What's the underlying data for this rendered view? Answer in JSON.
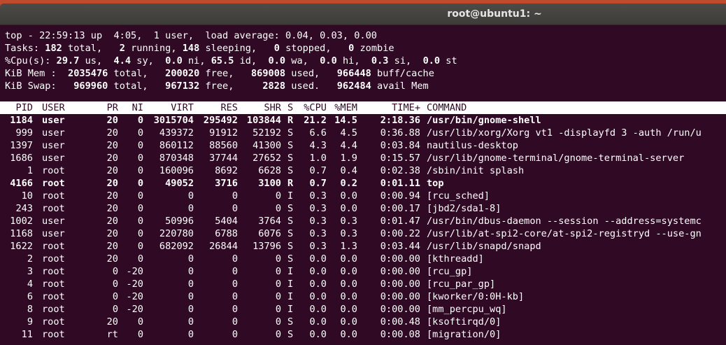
{
  "window": {
    "title": "root@ubuntu1: ~"
  },
  "summary": [
    {
      "parts": [
        {
          "t": "top - 22:59:13 up  4:05,  1 user,  load average: 0.04, 0.03, 0.00"
        }
      ]
    },
    {
      "parts": [
        {
          "t": "Tasks: "
        },
        {
          "t": "182",
          "b": true
        },
        {
          "t": " total,   "
        },
        {
          "t": "2",
          "b": true
        },
        {
          "t": " running, "
        },
        {
          "t": "148",
          "b": true
        },
        {
          "t": " sleeping,   "
        },
        {
          "t": "0",
          "b": true
        },
        {
          "t": " stopped,   "
        },
        {
          "t": "0",
          "b": true
        },
        {
          "t": " zombie"
        }
      ]
    },
    {
      "parts": [
        {
          "t": "%Cpu(s): "
        },
        {
          "t": "29.7",
          "b": true
        },
        {
          "t": " us,  "
        },
        {
          "t": "4.4",
          "b": true
        },
        {
          "t": " sy,  "
        },
        {
          "t": "0.0",
          "b": true
        },
        {
          "t": " ni, "
        },
        {
          "t": "65.5",
          "b": true
        },
        {
          "t": " id,  "
        },
        {
          "t": "0.0",
          "b": true
        },
        {
          "t": " wa,  "
        },
        {
          "t": "0.0",
          "b": true
        },
        {
          "t": " hi,  "
        },
        {
          "t": "0.3",
          "b": true
        },
        {
          "t": " si,  "
        },
        {
          "t": "0.0",
          "b": true
        },
        {
          "t": " st"
        }
      ]
    },
    {
      "parts": [
        {
          "t": "KiB Mem : "
        },
        {
          "t": " 2035476",
          "b": true
        },
        {
          "t": " total,  "
        },
        {
          "t": " 200020",
          "b": true
        },
        {
          "t": " free,  "
        },
        {
          "t": " 869008",
          "b": true
        },
        {
          "t": " used,  "
        },
        {
          "t": " 966448",
          "b": true
        },
        {
          "t": " buff/cache"
        }
      ]
    },
    {
      "parts": [
        {
          "t": "KiB Swap: "
        },
        {
          "t": "  969960",
          "b": true
        },
        {
          "t": " total,  "
        },
        {
          "t": " 967132",
          "b": true
        },
        {
          "t": " free,  "
        },
        {
          "t": "   2828",
          "b": true
        },
        {
          "t": " used.  "
        },
        {
          "t": " 962484",
          "b": true
        },
        {
          "t": " avail Mem"
        }
      ]
    }
  ],
  "columns": [
    "PID",
    "USER",
    "PR",
    "NI",
    "VIRT",
    "RES",
    "SHR",
    "S",
    "%CPU",
    "%MEM",
    "TIME+",
    "COMMAND"
  ],
  "processes": [
    {
      "pid": "1184",
      "user": "user",
      "pr": "20",
      "ni": "0",
      "virt": "3015704",
      "res": "295492",
      "shr": "103844",
      "s": "R",
      "cpu": "21.2",
      "mem": "14.5",
      "time": "2:18.36",
      "cmd": "/usr/bin/gnome-shell",
      "bold": true
    },
    {
      "pid": "999",
      "user": "user",
      "pr": "20",
      "ni": "0",
      "virt": "439372",
      "res": "91912",
      "shr": "52192",
      "s": "S",
      "cpu": "6.6",
      "mem": "4.5",
      "time": "0:36.88",
      "cmd": "/usr/lib/xorg/Xorg vt1 -displayfd 3 -auth /run/u",
      "bold": false
    },
    {
      "pid": "1397",
      "user": "user",
      "pr": "20",
      "ni": "0",
      "virt": "860112",
      "res": "88560",
      "shr": "41300",
      "s": "S",
      "cpu": "4.3",
      "mem": "4.4",
      "time": "0:03.84",
      "cmd": "nautilus-desktop",
      "bold": false
    },
    {
      "pid": "1686",
      "user": "user",
      "pr": "20",
      "ni": "0",
      "virt": "870348",
      "res": "37744",
      "shr": "27652",
      "s": "S",
      "cpu": "1.0",
      "mem": "1.9",
      "time": "0:15.57",
      "cmd": "/usr/lib/gnome-terminal/gnome-terminal-server",
      "bold": false
    },
    {
      "pid": "1",
      "user": "root",
      "pr": "20",
      "ni": "0",
      "virt": "160096",
      "res": "8692",
      "shr": "6628",
      "s": "S",
      "cpu": "0.7",
      "mem": "0.4",
      "time": "0:02.38",
      "cmd": "/sbin/init splash",
      "bold": false
    },
    {
      "pid": "4166",
      "user": "root",
      "pr": "20",
      "ni": "0",
      "virt": "49052",
      "res": "3716",
      "shr": "3100",
      "s": "R",
      "cpu": "0.7",
      "mem": "0.2",
      "time": "0:01.11",
      "cmd": "top",
      "bold": true
    },
    {
      "pid": "10",
      "user": "root",
      "pr": "20",
      "ni": "0",
      "virt": "0",
      "res": "0",
      "shr": "0",
      "s": "I",
      "cpu": "0.3",
      "mem": "0.0",
      "time": "0:00.94",
      "cmd": "[rcu_sched]",
      "bold": false
    },
    {
      "pid": "243",
      "user": "root",
      "pr": "20",
      "ni": "0",
      "virt": "0",
      "res": "0",
      "shr": "0",
      "s": "S",
      "cpu": "0.3",
      "mem": "0.0",
      "time": "0:00.17",
      "cmd": "[jbd2/sda1-8]",
      "bold": false
    },
    {
      "pid": "1002",
      "user": "user",
      "pr": "20",
      "ni": "0",
      "virt": "50996",
      "res": "5404",
      "shr": "3764",
      "s": "S",
      "cpu": "0.3",
      "mem": "0.3",
      "time": "0:01.47",
      "cmd": "/usr/bin/dbus-daemon --session --address=systemc",
      "bold": false
    },
    {
      "pid": "1168",
      "user": "user",
      "pr": "20",
      "ni": "0",
      "virt": "220780",
      "res": "6788",
      "shr": "6076",
      "s": "S",
      "cpu": "0.3",
      "mem": "0.3",
      "time": "0:00.22",
      "cmd": "/usr/lib/at-spi2-core/at-spi2-registryd --use-gn",
      "bold": false
    },
    {
      "pid": "1622",
      "user": "root",
      "pr": "20",
      "ni": "0",
      "virt": "682092",
      "res": "26844",
      "shr": "13796",
      "s": "S",
      "cpu": "0.3",
      "mem": "1.3",
      "time": "0:03.44",
      "cmd": "/usr/lib/snapd/snapd",
      "bold": false
    },
    {
      "pid": "2",
      "user": "root",
      "pr": "20",
      "ni": "0",
      "virt": "0",
      "res": "0",
      "shr": "0",
      "s": "S",
      "cpu": "0.0",
      "mem": "0.0",
      "time": "0:00.00",
      "cmd": "[kthreadd]",
      "bold": false
    },
    {
      "pid": "3",
      "user": "root",
      "pr": "0",
      "ni": "-20",
      "virt": "0",
      "res": "0",
      "shr": "0",
      "s": "I",
      "cpu": "0.0",
      "mem": "0.0",
      "time": "0:00.00",
      "cmd": "[rcu_gp]",
      "bold": false
    },
    {
      "pid": "4",
      "user": "root",
      "pr": "0",
      "ni": "-20",
      "virt": "0",
      "res": "0",
      "shr": "0",
      "s": "I",
      "cpu": "0.0",
      "mem": "0.0",
      "time": "0:00.00",
      "cmd": "[rcu_par_gp]",
      "bold": false
    },
    {
      "pid": "6",
      "user": "root",
      "pr": "0",
      "ni": "-20",
      "virt": "0",
      "res": "0",
      "shr": "0",
      "s": "I",
      "cpu": "0.0",
      "mem": "0.0",
      "time": "0:00.00",
      "cmd": "[kworker/0:0H-kb]",
      "bold": false
    },
    {
      "pid": "8",
      "user": "root",
      "pr": "0",
      "ni": "-20",
      "virt": "0",
      "res": "0",
      "shr": "0",
      "s": "I",
      "cpu": "0.0",
      "mem": "0.0",
      "time": "0:00.00",
      "cmd": "[mm_percpu_wq]",
      "bold": false
    },
    {
      "pid": "9",
      "user": "root",
      "pr": "20",
      "ni": "0",
      "virt": "0",
      "res": "0",
      "shr": "0",
      "s": "S",
      "cpu": "0.0",
      "mem": "0.0",
      "time": "0:00.48",
      "cmd": "[ksoftirqd/0]",
      "bold": false
    },
    {
      "pid": "11",
      "user": "root",
      "pr": "rt",
      "ni": "0",
      "virt": "0",
      "res": "0",
      "shr": "0",
      "s": "S",
      "cpu": "0.0",
      "mem": "0.0",
      "time": "0:00.08",
      "cmd": "[migration/0]",
      "bold": false
    }
  ]
}
